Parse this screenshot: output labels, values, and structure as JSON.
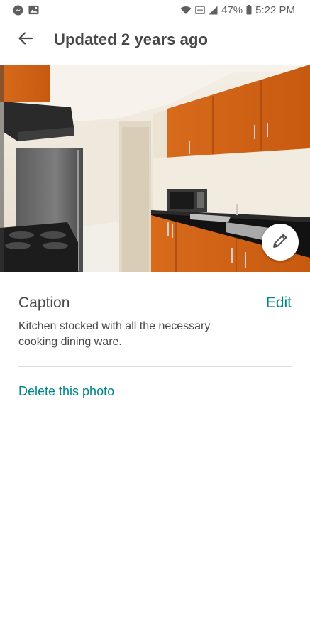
{
  "status_bar": {
    "battery": "47%",
    "time": "5:22 PM",
    "left_icons": [
      "messenger-icon",
      "gallery-icon"
    ],
    "right_icons": [
      "wifi-icon",
      "volte-icon",
      "signal-icon",
      "battery-icon"
    ]
  },
  "header": {
    "back_icon": "arrow-left-icon",
    "title": "Updated 2 years ago"
  },
  "photo": {
    "edit_icon": "pencil-icon"
  },
  "caption": {
    "heading": "Caption",
    "edit_label": "Edit",
    "text": "Kitchen stocked with all the necessary cooking dining ware."
  },
  "actions": {
    "delete_label": "Delete this photo"
  },
  "colors": {
    "accent": "#008489",
    "text": "#484848",
    "divider": "#dcdcdc"
  }
}
